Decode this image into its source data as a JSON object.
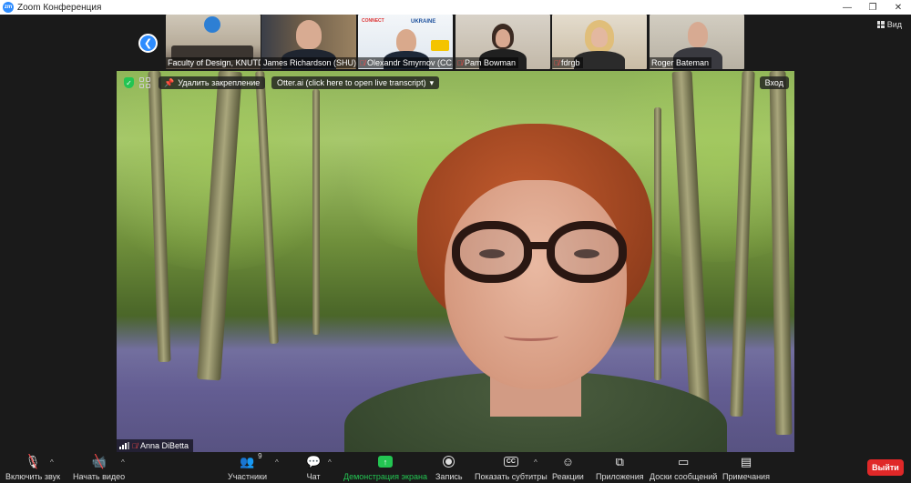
{
  "window": {
    "title": "Zoom Конференция",
    "logo_text": "zm",
    "controls": [
      "—",
      "❐",
      "✕"
    ]
  },
  "strip": {
    "view_label": "Вид",
    "thumbnails": [
      {
        "name": "Faculty of Design, KNUTD",
        "muted": false,
        "color": "#b9b2a6"
      },
      {
        "name": "James Richardson (SHU)",
        "muted": false,
        "color": "#8a6f55"
      },
      {
        "name": "Olexandr Smyrnov (CC...",
        "muted": true,
        "color": "#e9eef3"
      },
      {
        "name": "Pam Bowman",
        "muted": true,
        "color": "#cfc8bc"
      },
      {
        "name": "fdrgb",
        "muted": true,
        "color": "#d9cdb9"
      },
      {
        "name": "Roger Bateman",
        "muted": false,
        "color": "#c9c3b5"
      }
    ],
    "thumb_banner": {
      "line1": "CONNECT",
      "line2": "UKRAINE"
    }
  },
  "main": {
    "unpin_label": "Удалить закрепление",
    "otter_label": "Otter.ai (click here to open live transcript)",
    "enter_label": "Вход",
    "speaker_name": "Anna DiBetta"
  },
  "toolbar": {
    "unmute": "Включить звук",
    "start_video": "Начать видео",
    "participants": "Участники",
    "participants_count": "9",
    "chat": "Чат",
    "share": "Демонстрация экрана",
    "record": "Запись",
    "captions": "Показать субтитры",
    "captions_icon": "CC",
    "reactions": "Реакции",
    "apps": "Приложения",
    "whiteboards": "Доски сообщений",
    "notes": "Примечания",
    "leave": "Выйти"
  }
}
